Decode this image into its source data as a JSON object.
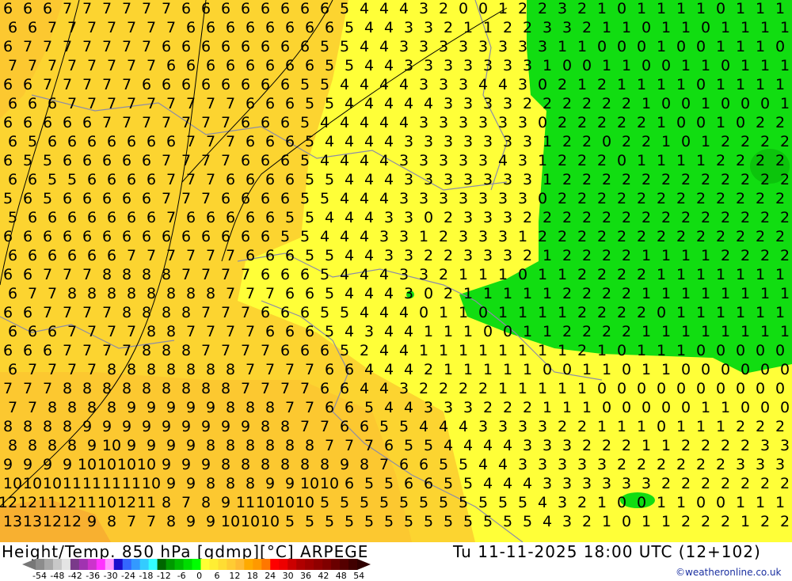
{
  "title": "Height/Temp. 850 hPa [gdmp][°C] ARPEGE",
  "datetime": "Tu 11-11-2025 18:00 UTC (12+102)",
  "credit": "©weatheronline.co.uk",
  "colors": {
    "warm_orange": "#fcc830",
    "base_yellow_orange": "#fcd430",
    "bright_yellow": "#ffff38",
    "green": "#11dd11",
    "dark_green": "#0cc40c",
    "deep_orange": "#f8b030",
    "border_gray": "#8c8ca8"
  },
  "colorbar": {
    "colors": [
      "#8c8c8c",
      "#a8a8a8",
      "#c8c8c8",
      "#e4e4e4",
      "#7a3a8a",
      "#a033b0",
      "#cc33cc",
      "#ff33ff",
      "#ff99ff",
      "#1a0dcc",
      "#3366ff",
      "#3399ff",
      "#33ccff",
      "#33ffff",
      "#006600",
      "#009900",
      "#00bb00",
      "#00dd00",
      "#00ff00",
      "#ffff33",
      "#ffee33",
      "#ffdd33",
      "#ffcc33",
      "#ffbb33",
      "#ffaa00",
      "#ff9900",
      "#ff7700",
      "#ff0000",
      "#ee0000",
      "#cc0000",
      "#b00000",
      "#a00000",
      "#900000",
      "#800000",
      "#6a0000",
      "#550000",
      "#400000"
    ],
    "labels": [
      "-54",
      "-48",
      "-42",
      "-36",
      "-30",
      "-24",
      "-18",
      "-12",
      "-6",
      "0",
      "6",
      "12",
      "18",
      "24",
      "30",
      "36",
      "42",
      "48",
      "54"
    ]
  },
  "grid_values": [
    "6 6 6 7 7 7 7 7 7 6 6 6 6 6 6 6 6 5 4 4 4 3 2 0 0 1 2 2 3 2 1 0 1 1 1 1 0 1 1 1",
    "6 6 7 7 7 7 7 7 7 6 6 6 6 6 6 6 6 5 4 4 3 3 2 1 1 2 2 3 3 2 1 1 0 1 1 0 1 1 1 1",
    "6 7 7 7 7 7 7 7 6 6 6 6 6 6 6 6 5 5 4 4 3 3 3 3 3 3 3 3 1 1 0 0 0 1 0 0 1 1 1 0",
    "7 7 7 7 7 7 7 7 6 6 6 6 6 6 6 6 5 5 4 4 3 3 3 3 3 3 3 1 0 0 1 1 0 0 1 1 0 1 1 1",
    "6 6 7 7 7 7 7 6 6 6 6 6 6 6 6 5 5 4 4 4 4 3 3 3 4 4 3 0 2 1 2 1 1 1 1 0 1 1 1 1",
    "6 6 6 7 7 7 7 7 7 7 7 7 6 6 6 5 5 4 4 4 4 4 3 3 3 3 2 2 2 2 2 2 1 0 0 1 0 0 0 1",
    "6 6 6 6 6 7 7 7 7 7 7 7 6 6 6 5 4 4 4 4 4 3 3 3 3 3 3 0 2 2 2 2 2 1 0 0 1 0 2 2",
    "6 5 6 6 6 6 6 6 6 7 7 7 6 6 6 5 4 4 4 4 3 3 3 3 3 3 3 1 2 2 0 2 2 1 0 1 2 2 2 2",
    "6 5 5 6 6 6 6 6 7 7 7 7 6 6 6 5 4 4 4 4 3 3 3 3 3 4 3 1 2 2 2 0 1 1 1 1 2 2 2 2",
    "6 6 5 5 6 6 6 6 7 7 7 6 6 6 6 5 5 4 4 4 3 3 3 3 3 3 3 1 2 2 2 2 2 2 2 2 2 2 2 2",
    "5 6 5 6 6 6 6 6 7 7 7 6 6 6 6 5 5 4 4 4 3 3 3 3 3 3 3 0 2 2 2 2 2 2 2 2 2 2 2 2",
    "5 6 6 6 6 6 6 6 7 6 6 6 6 6 5 5 4 4 4 3 3 0 2 3 3 3 2 2 2 2 2 2 2 2 2 2 2 2 2 2",
    "6 6 6 6 6 6 6 6 6 6 6 6 6 6 5 5 4 4 4 3 3 1 2 3 3 3 1 2 2 2 2 2 2 2 2 2 2 2 2 2",
    "6 6 6 6 6 6 7 7 7 7 7 7 6 6 6 5 5 4 4 3 3 2 2 3 3 3 2 1 2 2 2 2 1 1 1 1 2 2 2 2",
    "6 6 7 7 7 8 8 8 8 7 7 7 7 6 6 6 5 4 4 4 3 3 2 1 1 1 0 1 1 2 2 2 2 1 1 1 1 1 1 1",
    "6 7 7 8 8 8 8 8 8 8 8 7 7 7 6 6 5 4 4 4 3 0 2 1 1 1 1 1 2 2 2 2 1 1 1 1 1 1 1 1",
    "6 6 7 7 7 7 8 8 8 8 7 7 7 6 6 6 5 5 4 4 4 0 1 1 0 1 1 1 1 2 2 2 2 0 1 1 1 1 1 1",
    "6 6 6 7 7 7 7 8 8 7 7 7 7 6 6 6 5 4 3 4 4 1 1 1 0 0 1 1 2 2 2 2 1 1 1 1 1 1 1 1",
    "6 6 6 7 7 7 7 8 8 8 7 7 7 7 6 6 6 5 2 4 4 1 1 1 1 1 1 1 1 2 1 0 1 1 1 0 0 0 0 0",
    "6 7 7 7 7 8 8 8 8 8 8 8 7 7 7 7 6 6 4 4 4 2 1 1 1 1 1 0 0 1 1 0 1 1 0 0 0 0 0 0",
    "7 7 7 8 8 8 8 8 8 8 8 8 7 7 7 7 6 6 4 4 3 2 2 2 2 1 1 1 1 1 0 0 0 0 0 0 0 0 0 0",
    "7 7 8 8 8 8 9 9 9 9 9 8 8 8 7 7 6 6 5 4 4 3 3 3 2 2 2 1 1 1 0 0 0 0 0 1 1 0 0 0",
    "8 8 8 8 9 9 9 9 9 9 9 9 9 8 8 7 7 6 6 5 5 4 4 4 3 3 3 3 2 2 1 1 1 0 1 1 1 2 2 2",
    "8 8 8 8 9 10 9 9 9 9 8 8 8 8 8 8 7 7 7 6 5 5 4 4 4 4 3 3 3 2 2 2 1 1 2 2 2 2 3 3",
    "9 9 9 9 10 10 10 10 9 9 9 8 8 8 8 8 8 9 8 7 6 6 5 5 4 4 3 3 3 3 3 2 2 2 2 2 2 3 3 3",
    "10 10 10 11 11 11 11 10 9 9 8 8 8 9 9 10 10 6 5 5 6 6 5 5 4 4 4 3 3 3 3 3 3 2 2 2 2 2 2 2",
    "12 12 11 12 11 10 12 11 8 7 8 9 11 10 10 10 5 5 5 5 5 5 5 5 5 5 5 4 3 2 1 0 0 1 1 0 0 1 1 1",
    "13 13 12 12 9 8 7 7 8 9 9 10 10 10 5 5 5 5 5 5 5 5 5 5 5 5 5 4 3 2 1 0 1 1 2 2 2 1 2 2"
  ]
}
